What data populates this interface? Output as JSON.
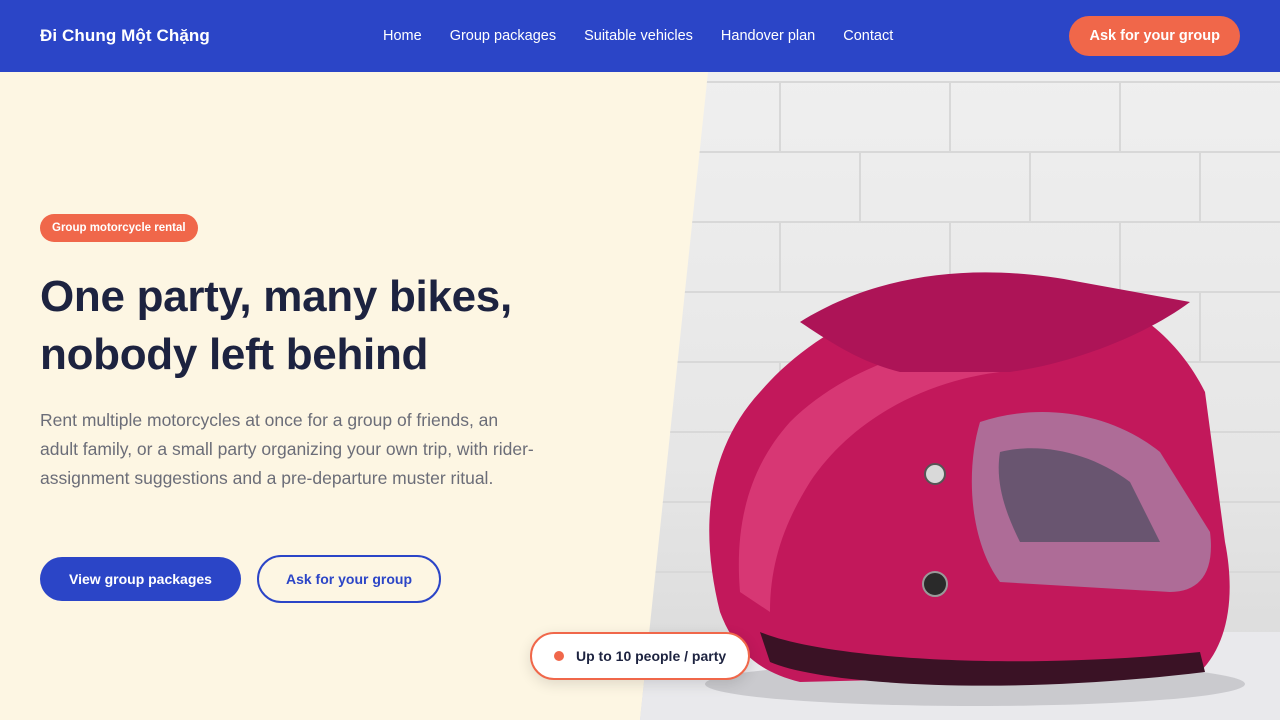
{
  "header": {
    "brand": "Đi Chung Một Chặng",
    "nav": [
      "Home",
      "Group packages",
      "Suitable vehicles",
      "Handover plan",
      "Contact"
    ],
    "cta_label": "Ask for your group"
  },
  "hero": {
    "badge": "Group motorcycle rental",
    "headline_line1": "One party, many bikes,",
    "headline_line2": "nobody left behind",
    "subtext": "Rent multiple motorcycles at once for a group of friends, an adult family, or a small party organizing your own trip, with rider-assignment suggestions and a pre-departure muster ritual.",
    "primary_button": "View group packages",
    "secondary_button": "Ask for your group",
    "capacity_pill": "Up to 10 people / party"
  },
  "colors": {
    "header_bg": "#2b45c7",
    "accent": "#f0674a",
    "page_bg": "#fdf6e3",
    "heading": "#1d2340"
  }
}
